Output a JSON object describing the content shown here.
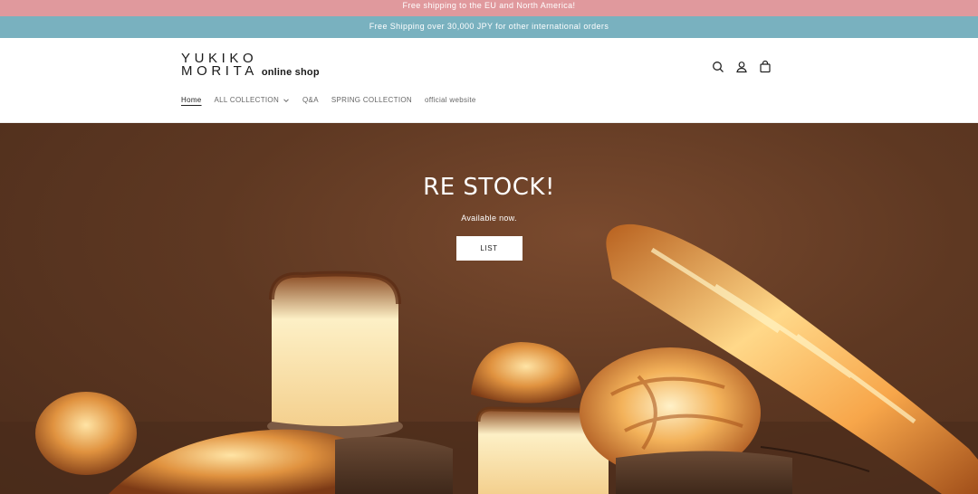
{
  "announcements": {
    "bar1": "Free shipping to the EU and North America!",
    "bar2": "Free Shipping over 30,000 JPY for other international orders"
  },
  "brand": {
    "line1": "YUKIKO",
    "line2": "MORITA",
    "subtitle": "online shop"
  },
  "nav": {
    "items": [
      {
        "label": "Home",
        "active": true
      },
      {
        "label": "ALL COLLECTION",
        "has_dropdown": true
      },
      {
        "label": "Q&A"
      },
      {
        "label": "SPRING COLLECTION"
      },
      {
        "label": "official website"
      }
    ]
  },
  "header_icons": [
    "search-icon",
    "account-icon",
    "cart-icon"
  ],
  "hero": {
    "title": "RE STOCK!",
    "subtitle": "Available now.",
    "button": "LIST"
  },
  "colors": {
    "bar1": "#e0999d",
    "bar2": "#79b1bf",
    "hero_bg": "#5e3822"
  }
}
